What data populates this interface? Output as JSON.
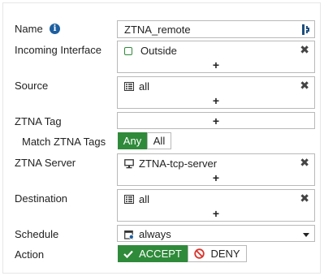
{
  "fields": {
    "name": {
      "label": "Name",
      "value": "ZTNA_remote"
    },
    "incoming_interface": {
      "label": "Incoming Interface",
      "entry": "Outside",
      "entry_icon": "interface-square-icon",
      "add": "+",
      "remove": "✖"
    },
    "source": {
      "label": "Source",
      "entry": "all",
      "entry_icon": "address-list-icon",
      "add": "+",
      "remove": "✖"
    },
    "ztna_tag": {
      "label": "ZTNA Tag",
      "add": "+"
    },
    "match_ztna_tags": {
      "label": "Match ZTNA Tags",
      "options": [
        "Any",
        "All"
      ],
      "selected": "Any"
    },
    "ztna_server": {
      "label": "ZTNA Server",
      "entry": "ZTNA-tcp-server",
      "entry_icon": "server-monitor-icon",
      "add": "+",
      "remove": "✖"
    },
    "destination": {
      "label": "Destination",
      "entry": "all",
      "entry_icon": "address-list-icon",
      "add": "+",
      "remove": "✖"
    },
    "schedule": {
      "label": "Schedule",
      "value": "always",
      "value_icon": "schedule-calendar-icon"
    },
    "action": {
      "label": "Action",
      "accept": "ACCEPT",
      "deny": "DENY",
      "selected": "ACCEPT"
    }
  },
  "colors": {
    "accent_green": "#2f8a3a",
    "deny_red": "#d9342b",
    "info_blue": "#1d5fa0"
  }
}
